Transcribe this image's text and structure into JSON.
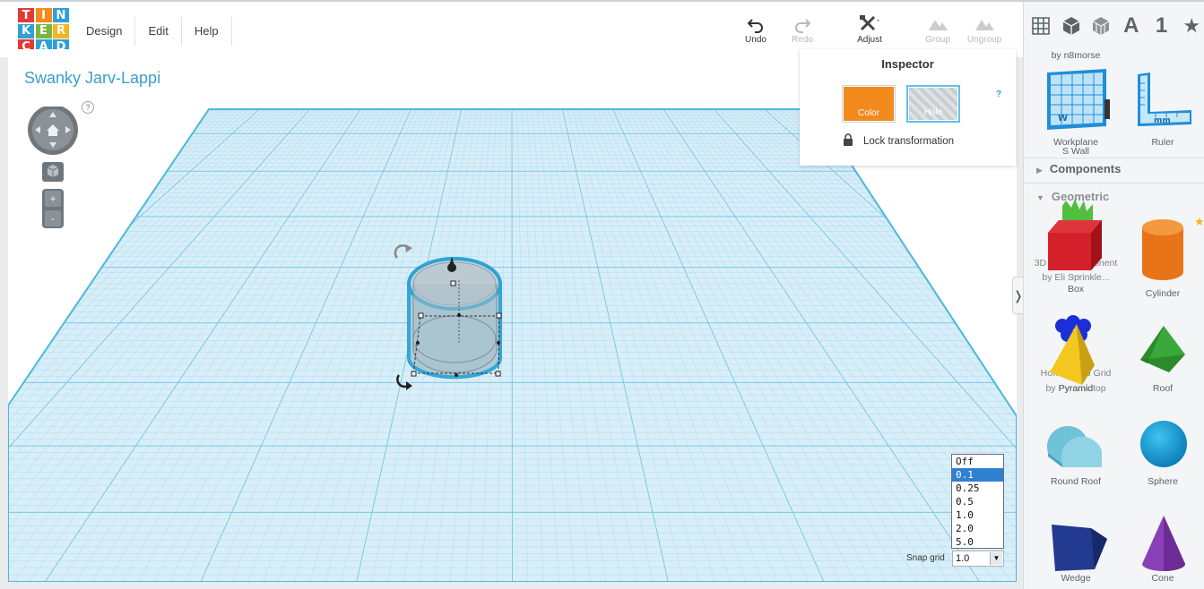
{
  "logo": {
    "letters": [
      "T",
      "I",
      "N",
      "K",
      "E",
      "R",
      "C",
      "A",
      "D"
    ]
  },
  "menu": [
    {
      "label": "Design"
    },
    {
      "label": "Edit"
    },
    {
      "label": "Help"
    }
  ],
  "toolbar": {
    "undo": "Undo",
    "redo": "Redo",
    "adjust": "Adjust",
    "group": "Group",
    "ungroup": "Ungroup"
  },
  "panel_tabs": {
    "text_tab": "A",
    "number_tab": "1"
  },
  "project": {
    "title": "Swanky Jarv-Lappi"
  },
  "nav": {
    "help": "?",
    "zoom_in": "+",
    "zoom_out": "-"
  },
  "inspector": {
    "title": "Inspector",
    "color_label": "Color",
    "hole_label": "Hole",
    "help": "?",
    "lock_label": "Lock transformation",
    "color_value": "#f28a1e"
  },
  "snap": {
    "label": "Snap grid",
    "value": "1.0",
    "options": [
      "Off",
      "0.1",
      "0.25",
      "0.5",
      "1.0",
      "2.0",
      "5.0"
    ],
    "highlighted": "0.1"
  },
  "library": {
    "byline_top": "by n8morse",
    "helpers": [
      {
        "label": "Workplane",
        "sub": "S Wall"
      },
      {
        "label": "Ruler"
      }
    ],
    "sections": {
      "components": "Components",
      "geometric": "Geometric"
    },
    "ghost_texts": {
      "item1a": "3D Text Component ...",
      "item1b": "by Eli Sprinkle...",
      "item2a": "Honeycomb Grid",
      "item2b": "by Pyramidtop"
    },
    "shapes": [
      {
        "label": "Box"
      },
      {
        "label": "Cylinder"
      },
      {
        "label": "Pyramid"
      },
      {
        "label": "Roof"
      },
      {
        "label": "Round Roof"
      },
      {
        "label": "Sphere"
      },
      {
        "label": "Wedge"
      },
      {
        "label": "Cone"
      }
    ]
  }
}
